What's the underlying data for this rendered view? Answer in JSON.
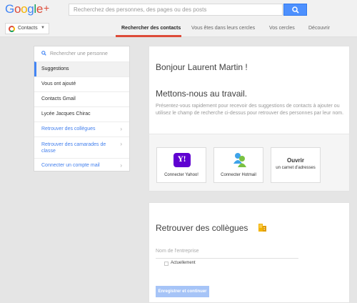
{
  "header": {
    "logo_letters": [
      {
        "ch": "G",
        "color": "#4285f4"
      },
      {
        "ch": "o",
        "color": "#dd4b39"
      },
      {
        "ch": "o",
        "color": "#f4b400"
      },
      {
        "ch": "g",
        "color": "#4285f4"
      },
      {
        "ch": "l",
        "color": "#0f9d58"
      },
      {
        "ch": "e",
        "color": "#dd4b39"
      }
    ],
    "logo_plus": "+",
    "search_placeholder": "Recherchez des personnes, des pages ou des posts"
  },
  "nav": {
    "contacts_label": "Contacts",
    "tabs": [
      {
        "label": "Rechercher des contacts",
        "active": true
      },
      {
        "label": "Vous êtes dans leurs cercles",
        "active": false
      },
      {
        "label": "Vos cercles",
        "active": false
      },
      {
        "label": "Découvrir",
        "active": false
      }
    ]
  },
  "sidebar": {
    "search_placeholder": "Rechercher une personne",
    "items": [
      {
        "label": "Suggestions"
      },
      {
        "label": "Vous ont ajouté"
      },
      {
        "label": "Contacts Gmail"
      },
      {
        "label": "Lycée Jacques Chirac"
      },
      {
        "label": "Retrouver des collègues"
      },
      {
        "label": "Retrouver des camarades de classe"
      },
      {
        "label": "Connecter un compte mail"
      }
    ]
  },
  "welcome": {
    "greeting": "Bonjour Laurent Martin !",
    "headline": "Mettons-nous au travail.",
    "description": "Présentez-vous rapidement pour recevoir des suggestions de contacts à ajouter ou utilisez le champ de recherche ci-dessus pour retrouver des personnes par leur nom.",
    "providers": [
      {
        "label": "Connecter Yahoo!",
        "logo_text": "Y!"
      },
      {
        "label": "Connecter Hotmail"
      },
      {
        "title": "Ouvrir",
        "label": "un carnet d'adresses"
      }
    ]
  },
  "colleagues": {
    "title": "Retrouver des collègues",
    "company_placeholder": "Nom de l'entreprise",
    "current_label": "Actuellement",
    "submit_label": "Enregistrer et continuer"
  },
  "colors": {
    "accent_blue": "#4285f4",
    "brand_red": "#dd4b39",
    "link_blue": "#427fed",
    "button_disabled": "#a6c4f7"
  }
}
